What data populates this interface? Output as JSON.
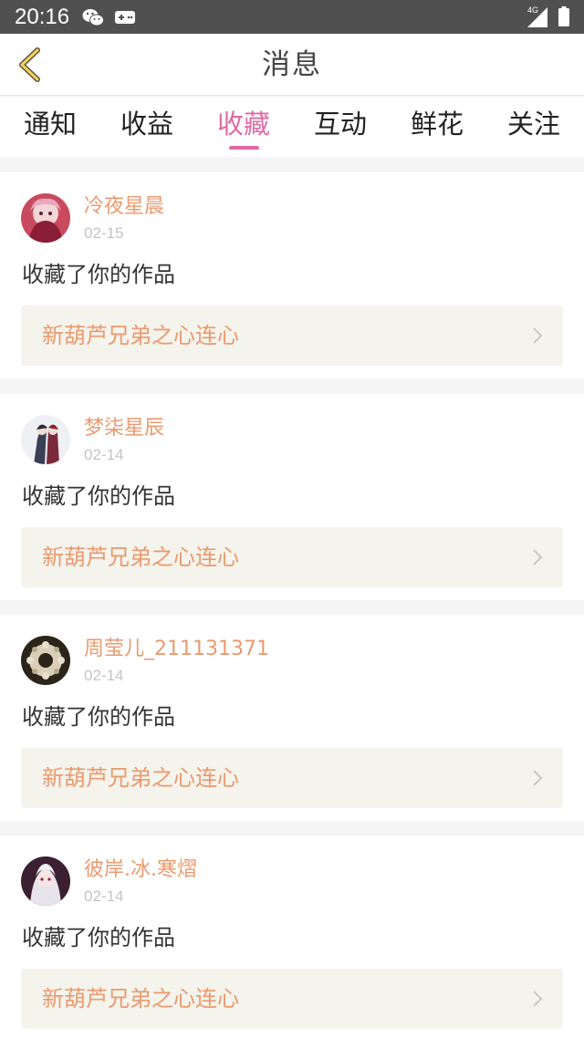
{
  "status_bar": {
    "time": "20:16",
    "network": "4G"
  },
  "header": {
    "title": "消息"
  },
  "tabs": [
    {
      "label": "通知"
    },
    {
      "label": "收益"
    },
    {
      "label": "收藏"
    },
    {
      "label": "互动"
    },
    {
      "label": "鲜花"
    },
    {
      "label": "关注"
    }
  ],
  "active_tab": "收藏",
  "colors": {
    "accent": "#e06ba4",
    "username": "#ea9a70",
    "link_bg": "#f4f3ec",
    "status_bar": "#505050"
  },
  "messages": [
    {
      "username": "冷夜星晨",
      "date": "02-15",
      "action": "收藏了你的作品",
      "work_title": "新葫芦兄弟之心连心"
    },
    {
      "username": "梦柒星辰",
      "date": "02-14",
      "action": "收藏了你的作品",
      "work_title": "新葫芦兄弟之心连心"
    },
    {
      "username": "周莹儿_211131371",
      "date": "02-14",
      "action": "收藏了你的作品",
      "work_title": "新葫芦兄弟之心连心"
    },
    {
      "username": "彼岸.冰.寒熠",
      "date": "02-14",
      "action": "收藏了你的作品",
      "work_title": "新葫芦兄弟之心连心"
    }
  ]
}
